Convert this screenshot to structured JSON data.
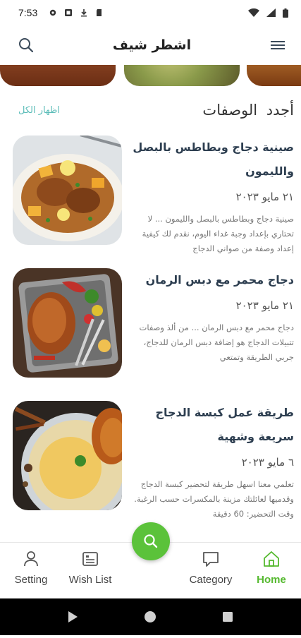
{
  "status_bar": {
    "time": "7:53"
  },
  "app_bar": {
    "title": "اشطر شيف"
  },
  "section": {
    "title": "أجدد  الوصفات",
    "show_all": "اظهار الكل"
  },
  "recipes": [
    {
      "title": "صينية دجاج وبطاطس بالبصل والليمون",
      "date": "٢١ مايو ٢٠٢٣",
      "desc": "صينية دجاج وبطاطس بالبصل والليمون ... لا تحتاري بإعداد وجبة غداء اليوم، نقدم لك كيفية إعداد وصفة من صواني الدجاج"
    },
    {
      "title": "دجاج محمر مع دبس الرمان",
      "date": "٢١ مايو ٢٠٢٣",
      "desc": "دجاج محمر مع دبس الرمان ... من ألذ وصفات تتبيلات الدجاج هو إضافة دبس الرمان للدجاج، جربي الطريقة وتمتعي"
    },
    {
      "title": "طريقة عمل كبسة الدجاج سريعة وشهية",
      "date": "٦ مايو ٢٠٢٣",
      "desc": "تعلمي معنا اسهل طريقة لتحضير كبسة الدجاج وقدميها لعائلتك مزينة بالمكسرات حسب الرغبة. وقت التحضير: 60 دقيقة"
    }
  ],
  "bottom_nav": {
    "setting": "Setting",
    "wishlist": "Wish List",
    "category": "Category",
    "home": "Home"
  },
  "colors": {
    "accent_green": "#55b92f",
    "link_teal": "#5cbdb9",
    "title_navy": "#2d3e50"
  }
}
